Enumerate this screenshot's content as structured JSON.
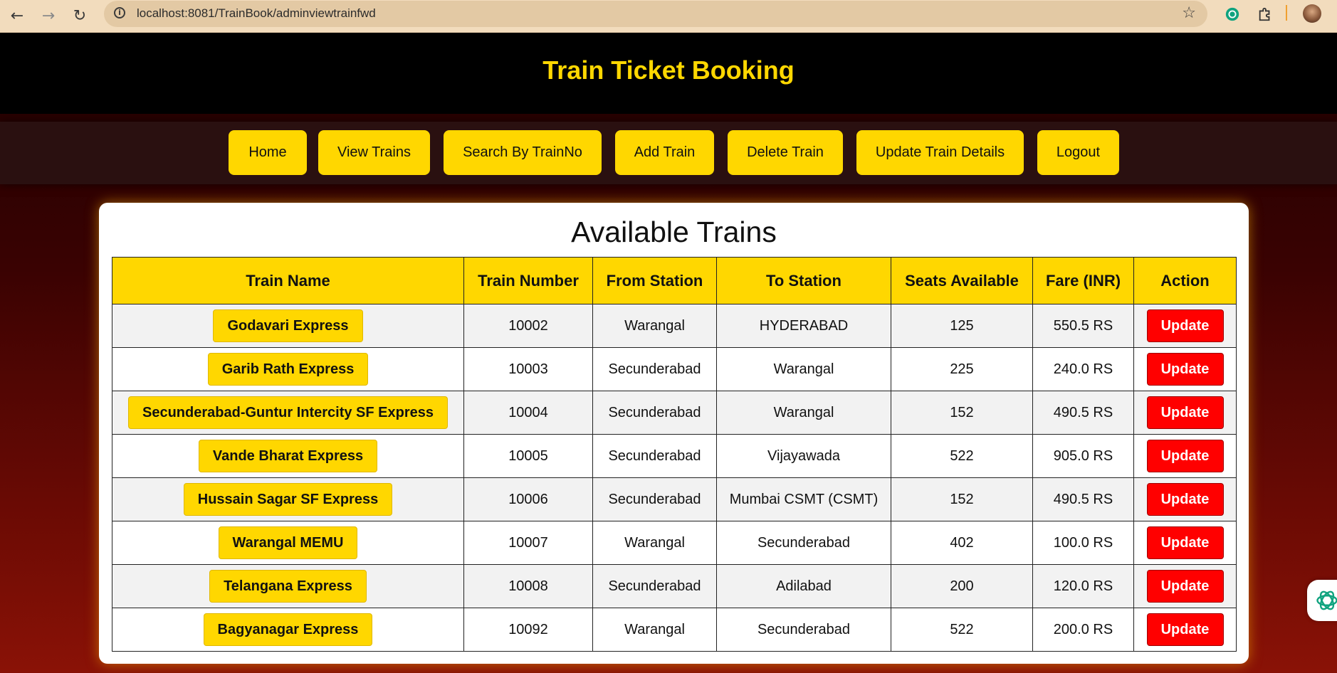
{
  "browser": {
    "url": "localhost:8081/TrainBook/adminviewtrainfwd",
    "back_icon": "back-arrow-icon",
    "forward_icon": "forward-arrow-icon",
    "reload_icon": "reload-icon"
  },
  "header": {
    "title": "Train Ticket Booking"
  },
  "nav": {
    "items": [
      {
        "label": "Home"
      },
      {
        "label": "View Trains"
      },
      {
        "label": "Search By TrainNo"
      },
      {
        "label": "Add Train"
      },
      {
        "label": "Delete Train"
      },
      {
        "label": "Update Train Details"
      },
      {
        "label": "Logout"
      }
    ]
  },
  "main": {
    "title": "Available Trains",
    "columns": [
      "Train Name",
      "Train Number",
      "From Station",
      "To Station",
      "Seats Available",
      "Fare (INR)",
      "Action"
    ],
    "action_label": "Update",
    "rows": [
      {
        "name": "Godavari Express",
        "number": "10002",
        "from": "Warangal",
        "to": "HYDERABAD",
        "seats": "125",
        "fare": "550.5 RS"
      },
      {
        "name": "Garib Rath Express",
        "number": "10003",
        "from": "Secunderabad",
        "to": "Warangal",
        "seats": "225",
        "fare": "240.0 RS"
      },
      {
        "name": "Secunderabad-Guntur Intercity SF Express",
        "number": "10004",
        "from": "Secunderabad",
        "to": "Warangal",
        "seats": "152",
        "fare": "490.5 RS"
      },
      {
        "name": "Vande Bharat Express",
        "number": "10005",
        "from": "Secunderabad",
        "to": "Vijayawada",
        "seats": "522",
        "fare": "905.0 RS"
      },
      {
        "name": "Hussain Sagar SF Express",
        "number": "10006",
        "from": "Secunderabad",
        "to": "Mumbai CSMT (CSMT)",
        "seats": "152",
        "fare": "490.5 RS"
      },
      {
        "name": "Warangal MEMU",
        "number": "10007",
        "from": "Warangal",
        "to": "Secunderabad",
        "seats": "402",
        "fare": "100.0 RS"
      },
      {
        "name": "Telangana Express",
        "number": "10008",
        "from": "Secunderabad",
        "to": "Adilabad",
        "seats": "200",
        "fare": "120.0 RS"
      },
      {
        "name": "Bagyanagar Express",
        "number": "10092",
        "from": "Warangal",
        "to": "Secunderabad",
        "seats": "522",
        "fare": "200.0 RS"
      }
    ]
  },
  "colors": {
    "accent": "#ffd700",
    "danger": "#ff0000",
    "header_bg": "#000000"
  }
}
